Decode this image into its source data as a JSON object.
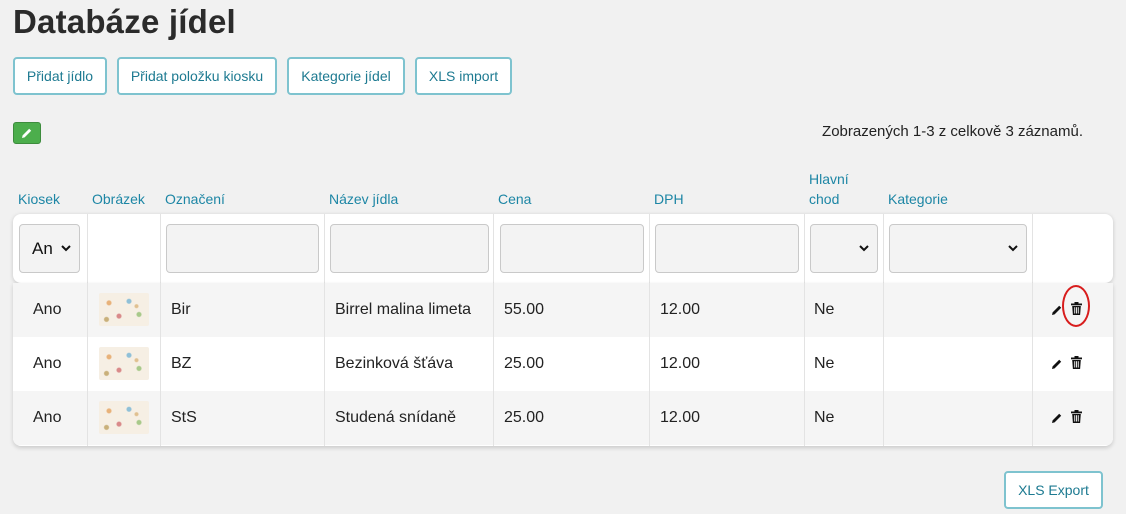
{
  "page_title": "Databáze jídel",
  "toolbar": {
    "add_meal": "Přidat jídlo",
    "add_kiosk_item": "Přidat položku kiosku",
    "meal_categories": "Kategorie jídel",
    "xls_import": "XLS import"
  },
  "records_info": "Zobrazených 1-3 z celkově 3 záznamů.",
  "columns": {
    "kiosk": "Kiosek",
    "image": "Obrázek",
    "label": "Označení",
    "name": "Název jídla",
    "price": "Cena",
    "vat": "DPH",
    "main_course_1": "Hlavní",
    "main_course_2": "chod",
    "category": "Kategorie"
  },
  "filters": {
    "kiosk_value": "An",
    "label_value": "",
    "name_value": "",
    "price_value": "",
    "vat_value": "",
    "main_course_value": "",
    "category_value": ""
  },
  "rows": [
    {
      "kiosk": "Ano",
      "label": "Bir",
      "name": "Birrel malina limeta",
      "price": "55.00",
      "vat": "12.00",
      "main_course": "Ne",
      "category": ""
    },
    {
      "kiosk": "Ano",
      "label": "BZ",
      "name": "Bezinková šťáva",
      "price": "25.00",
      "vat": "12.00",
      "main_course": "Ne",
      "category": ""
    },
    {
      "kiosk": "Ano",
      "label": "StS",
      "name": "Studená snídaně",
      "price": "25.00",
      "vat": "12.00",
      "main_course": "Ne",
      "category": ""
    }
  ],
  "footer": {
    "xls_export": "XLS Export"
  },
  "icons": {
    "edit": "pencil-icon",
    "delete": "trash-icon",
    "dropdown": "chevron-down-icon"
  },
  "colors": {
    "accent_text": "#1d86a5",
    "button_border": "#7ec3cf",
    "green_button": "#4cae4c",
    "highlight": "#d81d1d"
  }
}
